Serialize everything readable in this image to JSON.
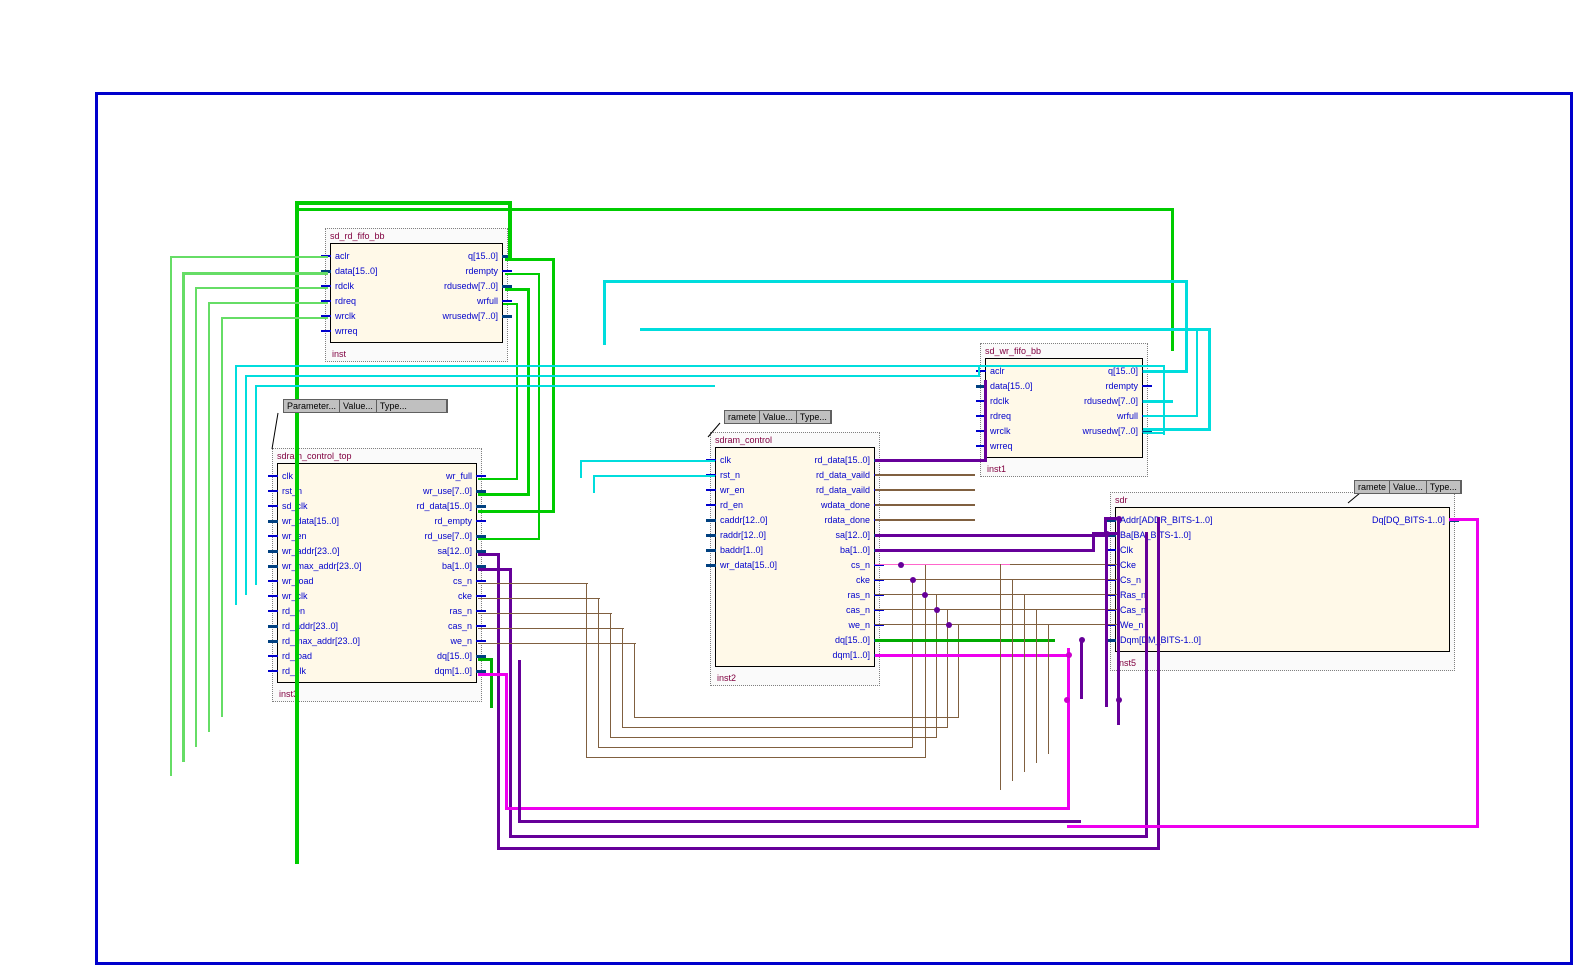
{
  "sheet": {
    "border_color": "#0000cc"
  },
  "blocks": {
    "rd_fifo": {
      "title": "sd_rd_fifo_bb",
      "inst": "inst",
      "left_ports": [
        "aclr",
        "data[15..0]",
        "rdclk",
        "rdreq",
        "wrclk",
        "wrreq"
      ],
      "right_ports": [
        "q[15..0]",
        "rdempty",
        "rdusedw[7..0]",
        "wrfull",
        "wrusedw[7..0]"
      ]
    },
    "wr_fifo": {
      "title": "sd_wr_fifo_bb",
      "inst": "inst1",
      "left_ports": [
        "aclr",
        "data[15..0]",
        "rdclk",
        "rdreq",
        "wrclk",
        "wrreq"
      ],
      "right_ports": [
        "q[15..0]",
        "rdempty",
        "rdusedw[7..0]",
        "wrfull",
        "wrusedw[7..0]"
      ]
    },
    "sdram_top": {
      "title": "sdram_control_top",
      "inst": "inst3",
      "param_cols": [
        "Parameter...",
        "Value...",
        "Type..."
      ],
      "left_ports": [
        "clk",
        "rst_n",
        "sd_clk",
        "wr_data[15..0]",
        "wr_en",
        "wr_addr[23..0]",
        "wr_max_addr[23..0]",
        "wr_load",
        "wr_clk",
        "rd_en",
        "rd_addr[23..0]",
        "rd_max_addr[23..0]",
        "rd_load",
        "rd_clk"
      ],
      "right_ports": [
        "wr_full",
        "wr_use[7..0]",
        "rd_data[15..0]",
        "rd_empty",
        "rd_use[7..0]",
        "sa[12..0]",
        "ba[1..0]",
        "cs_n",
        "cke",
        "ras_n",
        "cas_n",
        "we_n",
        "dq[15..0]",
        "dqm[1..0]"
      ]
    },
    "sdram_control": {
      "title": "sdram_control",
      "inst": "inst2",
      "param_cols": [
        "ramete",
        "Value...",
        "Type..."
      ],
      "left_ports": [
        "clk",
        "rst_n",
        "wr_en",
        "rd_en",
        "caddr[12..0]",
        "raddr[12..0]",
        "baddr[1..0]",
        "wr_data[15..0]"
      ],
      "right_ports": [
        "rd_data[15..0]",
        "rd_data_vaild",
        "rd_data_vaild",
        "wdata_done",
        "rdata_done",
        "sa[12..0]",
        "ba[1..0]",
        "cs_n",
        "cke",
        "ras_n",
        "cas_n",
        "we_n",
        "dq[15..0]",
        "dqm[1..0]"
      ]
    },
    "sdr": {
      "title": "sdr",
      "inst": "inst5",
      "param_cols": [
        "ramete",
        "Value...",
        "Type..."
      ],
      "left_ports": [
        "Addr[ADDR_BITS-1..0]",
        "Ba[BA_BITS-1..0]",
        "Clk",
        "Cke",
        "Cs_n",
        "Ras_n",
        "Cas_n",
        "We_n",
        "Dqm[DM_BITS-1..0]"
      ],
      "right_ports": [
        "Dq[DQ_BITS-1..0]"
      ]
    }
  },
  "colors": {
    "green": "#00cc00",
    "lightgreen": "#66dd66",
    "cyan": "#00dddd",
    "purple": "#660099",
    "darkpurple": "#4d004d",
    "brown": "#806040",
    "magenta": "#ee00ee",
    "pink": "#ff66cc"
  }
}
